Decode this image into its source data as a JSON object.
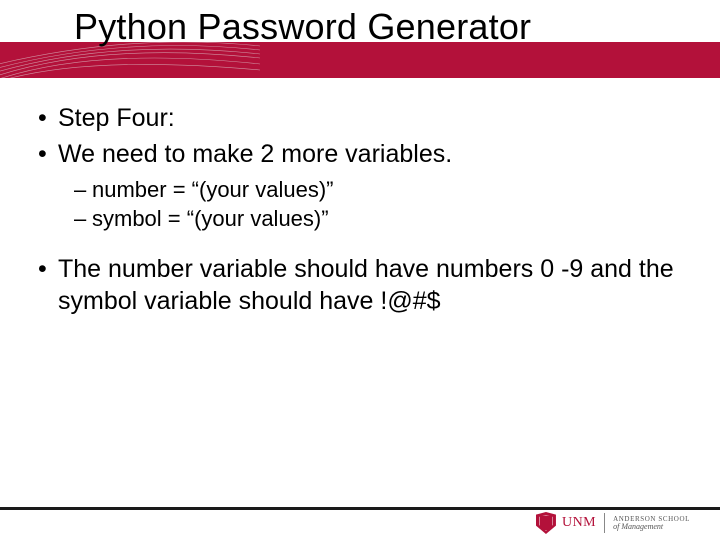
{
  "title": "Python Password Generator",
  "bullets": [
    "Step Four:",
    "We need to make 2 more variables."
  ],
  "subvars": [
    "number = “(your values)”",
    "symbol = “(your values)”"
  ],
  "desc": "The number variable should have numbers 0 -9 and the symbol variable should have !@#$",
  "logo": {
    "unm": "UNM",
    "school": "ANDERSON SCHOOL",
    "mgmt": "of Management"
  }
}
